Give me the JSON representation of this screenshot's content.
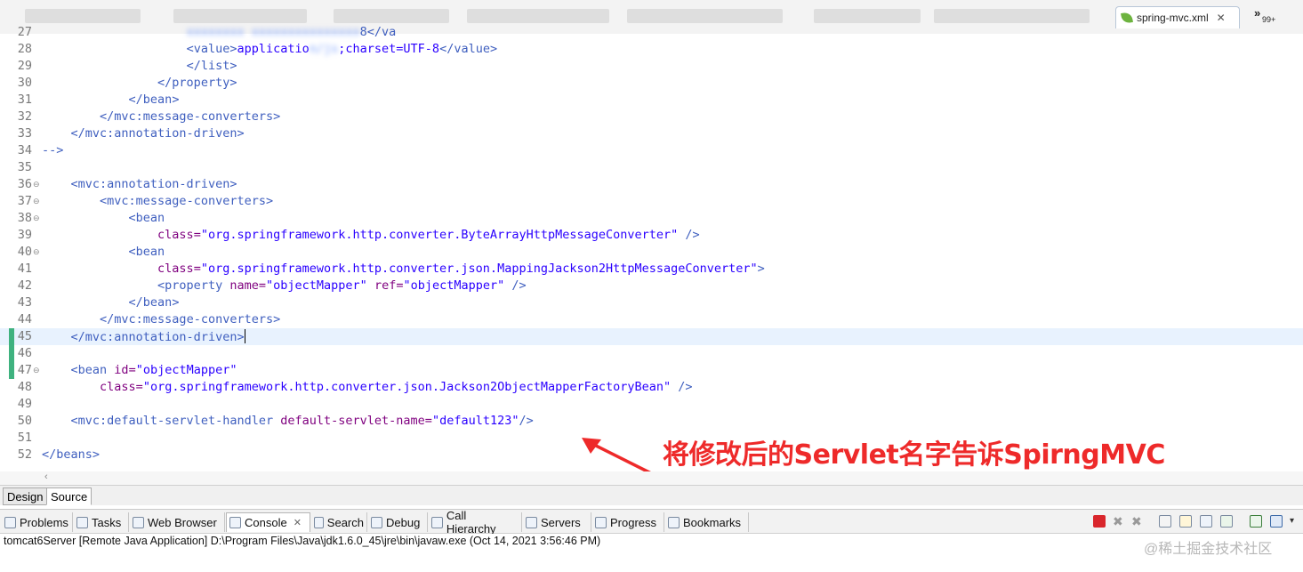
{
  "editor_tab": {
    "label": "spring-mvc.xml",
    "close": "✕",
    "overflow_chevron": "»",
    "overflow_count": "99+"
  },
  "lines": [
    {
      "n": "27",
      "frag": "partial"
    },
    {
      "n": "28",
      "frag": "value_line"
    },
    {
      "n": "29",
      "text": "                </list>"
    },
    {
      "n": "30",
      "text": "            </property>"
    },
    {
      "n": "31",
      "text": "        </bean>"
    },
    {
      "n": "32",
      "text": "    </mvc:message-converters>"
    },
    {
      "n": "33",
      "text": "</mvc:annotation-driven>"
    },
    {
      "n": "34",
      "text": "-->"
    },
    {
      "n": "35",
      "text": ""
    },
    {
      "n": "36",
      "text": "<mvc:annotation-driven>",
      "fold": "⊖"
    },
    {
      "n": "37",
      "text": "    <mvc:message-converters>",
      "fold": "⊖"
    },
    {
      "n": "38",
      "text": "        <bean",
      "fold": "⊖"
    },
    {
      "n": "39",
      "text": "            class=\"org.springframework.http.converter.ByteArrayHttpMessageConverter\" />"
    },
    {
      "n": "40",
      "text": "        <bean",
      "fold": "⊖"
    },
    {
      "n": "41",
      "text": "            class=\"org.springframework.http.converter.json.MappingJackson2HttpMessageConverter\">"
    },
    {
      "n": "42",
      "text": "            <property name=\"objectMapper\" ref=\"objectMapper\" />"
    },
    {
      "n": "43",
      "text": "        </bean>"
    },
    {
      "n": "44",
      "text": "    </mvc:message-converters>"
    },
    {
      "n": "45",
      "text": "</mvc:annotation-driven>"
    },
    {
      "n": "46",
      "text": ""
    },
    {
      "n": "47",
      "text": "<bean id=\"objectMapper\"",
      "fold": "⊖"
    },
    {
      "n": "48",
      "text": "    class=\"org.springframework.http.converter.json.Jackson2ObjectMapperFactoryBean\" />"
    },
    {
      "n": "49",
      "text": ""
    },
    {
      "n": "50",
      "text": "<mvc:default-servlet-handler default-servlet-name=\"default123\"/>"
    },
    {
      "n": "51",
      "text": ""
    },
    {
      "n": "52",
      "text": "</beans>"
    }
  ],
  "line28": {
    "value_open": "<value>",
    "value_blur": "applicatio",
    "charset": ";charset=UTF-8",
    "value_close": "</value>"
  },
  "annotation": "将修改后的Servlet名字告诉SpirngMVC",
  "mode_tabs": {
    "design": "Design",
    "source": "Source"
  },
  "views": [
    {
      "label": "Problems",
      "icon": "problems-icon"
    },
    {
      "label": "Tasks",
      "icon": "tasks-icon"
    },
    {
      "label": "Web Browser",
      "icon": "globe-icon"
    },
    {
      "label": "Console",
      "icon": "console-icon",
      "active": true
    },
    {
      "label": "Search",
      "icon": "search-icon"
    },
    {
      "label": "Debug",
      "icon": "bug-icon"
    },
    {
      "label": "Call Hierarchy",
      "icon": "hierarchy-icon"
    },
    {
      "label": "Servers",
      "icon": "servers-icon"
    },
    {
      "label": "Progress",
      "icon": "progress-icon"
    },
    {
      "label": "Bookmarks",
      "icon": "bookmark-icon"
    }
  ],
  "console_close": "✕",
  "console_text": "tomcat6Server [Remote Java Application] D:\\Program Files\\Java\\jdk1.6.0_45\\jre\\bin\\javaw.exe (Oct 14, 2021 3:56:46 PM)",
  "watermark": "@稀土掘金技术社区",
  "colors": {
    "tag": "#3f5fbf",
    "attr": "#7f007f",
    "value": "#2a00ff",
    "annotation": "#ee2a2a",
    "current_line": "#e8f2fe",
    "change_marker": "#3fb27f"
  }
}
